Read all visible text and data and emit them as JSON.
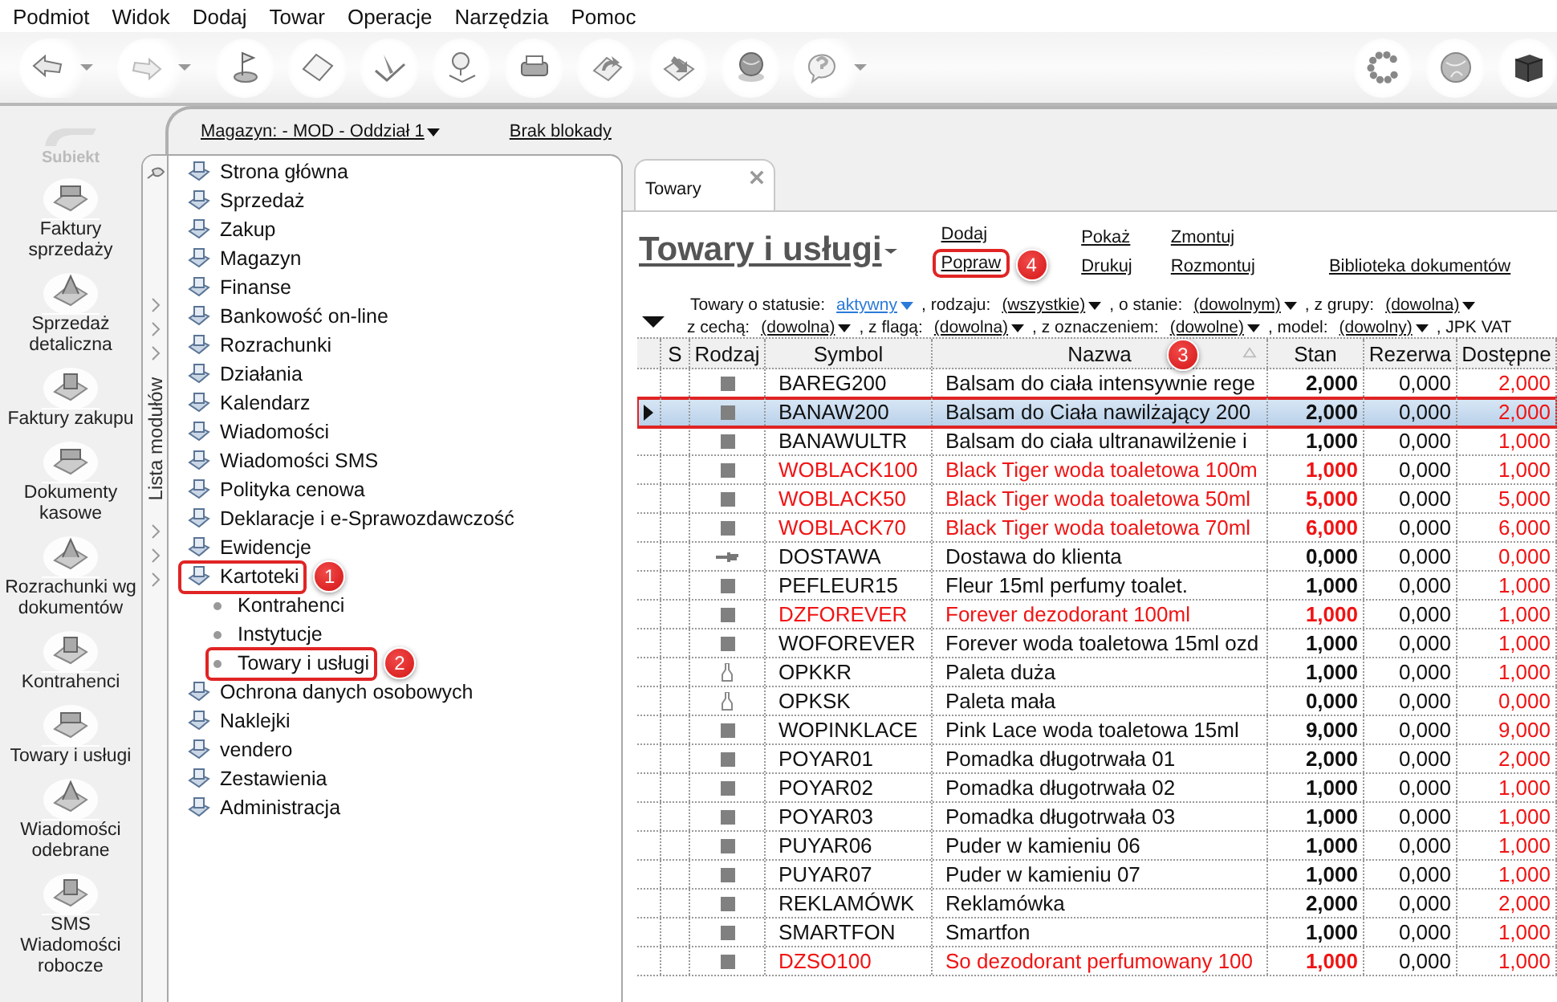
{
  "menu": [
    "Podmiot",
    "Widok",
    "Dodaj",
    "Towar",
    "Operacje",
    "Narzędzia",
    "Pomoc"
  ],
  "toolbar": [
    {
      "dropdown": true
    },
    {
      "dropdown": true
    },
    {
      "dropdown": false
    },
    {
      "dropdown": false
    },
    {
      "dropdown": false
    },
    {
      "dropdown": false
    },
    {
      "dropdown": false
    },
    {
      "dropdown": false
    },
    {
      "dropdown": false
    },
    {
      "dropdown": false
    },
    {
      "dropdown": true
    }
  ],
  "logo": {
    "text": "Subiekt"
  },
  "sidebar": {
    "items": [
      {
        "label": "Faktury sprzedaży"
      },
      {
        "label": "Sprzedaż detaliczna"
      },
      {
        "label": "Faktury zakupu"
      },
      {
        "label": "Dokumenty kasowe"
      },
      {
        "label": "Rozrachunki wg dokumentów"
      },
      {
        "label": "Kontrahenci"
      },
      {
        "label": "Towary i usługi"
      },
      {
        "label": "Wiadomości odebrane"
      },
      {
        "label": "SMS Wiadomości robocze"
      }
    ]
  },
  "topbar": {
    "warehouse": "Magazyn: - MOD - Oddział 1",
    "lock": "Brak blokady"
  },
  "module_strip": {
    "title": "Lista modułów"
  },
  "tree": {
    "items": [
      {
        "label": "Strona główna",
        "highlighted": false
      },
      {
        "label": "Sprzedaż",
        "highlighted": false
      },
      {
        "label": "Zakup",
        "highlighted": false
      },
      {
        "label": "Magazyn",
        "highlighted": false
      },
      {
        "label": "Finanse",
        "highlighted": false
      },
      {
        "label": "Bankowość on-line",
        "highlighted": false
      },
      {
        "label": "Rozrachunki",
        "highlighted": false
      },
      {
        "label": "Działania",
        "highlighted": false
      },
      {
        "label": "Kalendarz",
        "highlighted": false
      },
      {
        "label": "Wiadomości",
        "highlighted": false
      },
      {
        "label": "Wiadomości SMS",
        "highlighted": false
      },
      {
        "label": "Polityka cenowa",
        "highlighted": false
      },
      {
        "label": "Deklaracje i e-Sprawozdawczość",
        "highlighted": false
      },
      {
        "label": "Ewidencje",
        "highlighted": false
      },
      {
        "label": "Kartoteki",
        "highlighted": true,
        "callout": "1",
        "children": [
          {
            "label": "Kontrahenci",
            "highlighted": false
          },
          {
            "label": "Instytucje",
            "highlighted": false
          },
          {
            "label": "Towary i usługi",
            "highlighted": true,
            "callout": "2"
          }
        ]
      },
      {
        "label": "Ochrona danych osobowych",
        "highlighted": false
      },
      {
        "label": "Naklejki",
        "highlighted": false
      },
      {
        "label": "vendero",
        "highlighted": false
      },
      {
        "label": "Zestawienia",
        "highlighted": false
      },
      {
        "label": "Administracja",
        "highlighted": false
      }
    ]
  },
  "tabs": [
    {
      "label": "Towary",
      "selected": true
    }
  ],
  "title": "Towary i usługi",
  "actions": [
    {
      "items": [
        {
          "label": "Dodaj",
          "highlighted": false
        },
        {
          "label": "Popraw",
          "highlighted": true,
          "callout": "4"
        }
      ]
    },
    {
      "items": [
        {
          "label": "Pokaż",
          "highlighted": false
        },
        {
          "label": "Drukuj",
          "highlighted": false
        }
      ]
    },
    {
      "items": [
        {
          "label": "Zmontuj",
          "highlighted": false
        },
        {
          "label": "Rozmontuj",
          "highlighted": false
        }
      ]
    },
    {
      "items": [
        {
          "label": "Biblioteka dokumentów",
          "highlighted": false
        }
      ]
    }
  ],
  "filters": [
    [
      {
        "label": "Towary o statusie:",
        "value": "aktywny",
        "active": true
      },
      {
        "label": ", rodzaju:",
        "value": "(wszystkie)",
        "active": false
      },
      {
        "label": ", o stanie:",
        "value": "(dowolnym)",
        "active": false
      },
      {
        "label": ", z grupy:",
        "value": "(dowolna)",
        "active": false
      }
    ],
    [
      {
        "label": "z cechą:",
        "value": "(dowolna)",
        "active": false
      },
      {
        "label": ", z flagą:",
        "value": "(dowolna)",
        "active": false
      },
      {
        "label": ", z oznaczeniem:",
        "value": "(dowolne)",
        "active": false
      },
      {
        "label": ", model:",
        "value": "(dowolny)",
        "active": false
      },
      {
        "label": ", JPK VAT"
      }
    ]
  ],
  "table": {
    "columns": [
      {
        "label": "S",
        "sorted": false
      },
      {
        "label": "Rodzaj",
        "sorted": false
      },
      {
        "label": "Symbol",
        "sorted": false
      },
      {
        "label": "Nazwa",
        "sorted": true,
        "callout": "3"
      },
      {
        "label": "Stan",
        "sorted": false
      },
      {
        "label": "Rezerwa",
        "sorted": false
      },
      {
        "label": "Dostępne",
        "sorted": false
      }
    ],
    "rows": [
      {
        "kind": "goods",
        "symbol": "BAREG200",
        "name": "Balsam do ciała intensywnie rege",
        "stock": "2,000",
        "reserved": "0,000",
        "available": "2,000",
        "warning": false,
        "selected": false,
        "marked": false
      },
      {
        "kind": "goods",
        "symbol": "BANAW200",
        "name": "Balsam do Ciała nawilżający 200",
        "stock": "2,000",
        "reserved": "0,000",
        "available": "2,000",
        "warning": false,
        "selected": true,
        "marked": true
      },
      {
        "kind": "goods",
        "symbol": "BANAWULTR",
        "name": "Balsam do ciała ultranawilżenie i",
        "stock": "1,000",
        "reserved": "0,000",
        "available": "1,000",
        "warning": false,
        "selected": false,
        "marked": false
      },
      {
        "kind": "goods",
        "symbol": "WOBLACK100",
        "name": "Black Tiger woda toaletowa 100m",
        "stock": "1,000",
        "reserved": "0,000",
        "available": "1,000",
        "warning": true,
        "selected": false,
        "marked": false
      },
      {
        "kind": "goods",
        "symbol": "WOBLACK50",
        "name": "Black Tiger woda toaletowa 50ml",
        "stock": "5,000",
        "reserved": "0,000",
        "available": "5,000",
        "warning": true,
        "selected": false,
        "marked": false
      },
      {
        "kind": "goods",
        "symbol": "WOBLACK70",
        "name": "Black Tiger woda toaletowa 70ml",
        "stock": "6,000",
        "reserved": "0,000",
        "available": "6,000",
        "warning": true,
        "selected": false,
        "marked": false
      },
      {
        "kind": "service",
        "symbol": "DOSTAWA",
        "name": "Dostawa do klienta",
        "stock": "0,000",
        "reserved": "0,000",
        "available": "0,000",
        "warning": false,
        "selected": false,
        "marked": false
      },
      {
        "kind": "goods",
        "symbol": "PEFLEUR15",
        "name": "Fleur 15ml perfumy toalet.",
        "stock": "1,000",
        "reserved": "0,000",
        "available": "1,000",
        "warning": false,
        "selected": false,
        "marked": false
      },
      {
        "kind": "goods",
        "symbol": "DZFOREVER",
        "name": "Forever dezodorant 100ml",
        "stock": "1,000",
        "reserved": "0,000",
        "available": "1,000",
        "warning": true,
        "selected": false,
        "marked": false
      },
      {
        "kind": "goods",
        "symbol": "WOFOREVER",
        "name": "Forever woda toaletowa 15ml ozd",
        "stock": "1,000",
        "reserved": "0,000",
        "available": "1,000",
        "warning": false,
        "selected": false,
        "marked": false
      },
      {
        "kind": "packaging",
        "symbol": "OPKKR",
        "name": "Paleta duża",
        "stock": "1,000",
        "reserved": "0,000",
        "available": "1,000",
        "warning": false,
        "selected": false,
        "marked": false
      },
      {
        "kind": "packaging",
        "symbol": "OPKSK",
        "name": "Paleta mała",
        "stock": "0,000",
        "reserved": "0,000",
        "available": "0,000",
        "warning": false,
        "selected": false,
        "marked": false
      },
      {
        "kind": "goods",
        "symbol": "WOPINKLACE",
        "name": "Pink Lace woda toaletowa 15ml",
        "stock": "9,000",
        "reserved": "0,000",
        "available": "9,000",
        "warning": false,
        "selected": false,
        "marked": false
      },
      {
        "kind": "goods",
        "symbol": "POYAR01",
        "name": "Pomadka długotrwała 01",
        "stock": "2,000",
        "reserved": "0,000",
        "available": "2,000",
        "warning": false,
        "selected": false,
        "marked": false
      },
      {
        "kind": "goods",
        "symbol": "POYAR02",
        "name": "Pomadka długotrwała 02",
        "stock": "1,000",
        "reserved": "0,000",
        "available": "1,000",
        "warning": false,
        "selected": false,
        "marked": false
      },
      {
        "kind": "goods",
        "symbol": "POYAR03",
        "name": "Pomadka długotrwała 03",
        "stock": "1,000",
        "reserved": "0,000",
        "available": "1,000",
        "warning": false,
        "selected": false,
        "marked": false
      },
      {
        "kind": "goods",
        "symbol": "PUYAR06",
        "name": "Puder w kamieniu 06",
        "stock": "1,000",
        "reserved": "0,000",
        "available": "1,000",
        "warning": false,
        "selected": false,
        "marked": false
      },
      {
        "kind": "goods",
        "symbol": "PUYAR07",
        "name": "Puder w kamieniu 07",
        "stock": "1,000",
        "reserved": "0,000",
        "available": "1,000",
        "warning": false,
        "selected": false,
        "marked": false
      },
      {
        "kind": "goods",
        "symbol": "REKLAMÓWK",
        "name": "Reklamówka",
        "stock": "2,000",
        "reserved": "0,000",
        "available": "2,000",
        "warning": false,
        "selected": false,
        "marked": false
      },
      {
        "kind": "goods",
        "symbol": "SMARTFON",
        "name": "Smartfon",
        "stock": "1,000",
        "reserved": "0,000",
        "available": "1,000",
        "warning": false,
        "selected": false,
        "marked": false
      },
      {
        "kind": "goods",
        "symbol": "DZSO100",
        "name": "So dezodorant perfumowany 100",
        "stock": "1,000",
        "reserved": "0,000",
        "available": "1,000",
        "warning": true,
        "selected": false,
        "marked": false
      }
    ]
  }
}
